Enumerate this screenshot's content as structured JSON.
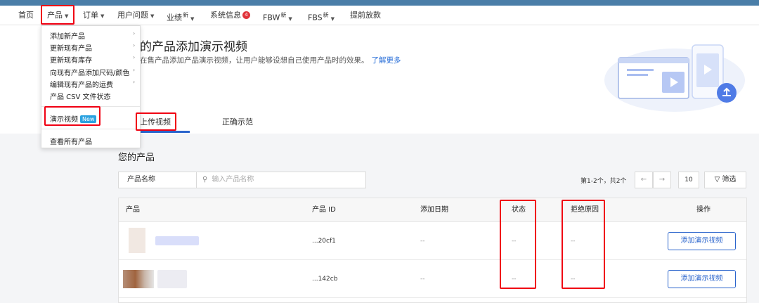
{
  "nav": {
    "home": "首页",
    "products": "产品",
    "orders": "订单",
    "user_issues": "用户问题",
    "performance": "业绩",
    "performance_sup": "新",
    "system_info": "系统信息",
    "system_info_badge": "4",
    "fbw": "FBW",
    "fbw_sup": "新",
    "fbs": "FBS",
    "fbs_sup": "新",
    "advance_payment": "提前放款"
  },
  "dropdown": {
    "items": [
      "添加新产品",
      "更新现有产品",
      "更新现有库存",
      "向现有产品添加尺码/颜色",
      "编辑现有产品的运费",
      "产品 CSV 文件状态"
    ],
    "demo_video": "演示视频",
    "new_badge": "New",
    "view_all": "查看所有产品"
  },
  "page": {
    "title": "为您的产品添加演示视频",
    "title_visible": "的产品添加演示视频",
    "desc": "在售产品添加产品演示视频，让用户能够设想自己使用产品时的效果。",
    "learn_more": "了解更多"
  },
  "tabs": {
    "upload": "上传视频",
    "example": "正确示范"
  },
  "section_title": "您的产品",
  "filter": {
    "field": "产品名称",
    "placeholder": "输入产品名称",
    "filter_button": "筛选"
  },
  "pager": {
    "text": "第1-2个，共2个",
    "page_size": "10",
    "prev": "←",
    "next": "→"
  },
  "table": {
    "headers": {
      "product": "产品",
      "product_id": "产品 ID",
      "date_added": "添加日期",
      "status": "状态",
      "reject_reason": "拒绝原因",
      "actions": "操作"
    },
    "rows": [
      {
        "product_id": "...20cf1",
        "date_added": "--",
        "status": "--",
        "reject_reason": "--",
        "action": "添加演示视频"
      },
      {
        "product_id": "...142cb",
        "date_added": "--",
        "status": "--",
        "reject_reason": "--",
        "action": "添加演示视频"
      }
    ]
  },
  "colors": {
    "accent": "#2a64cc",
    "highlight": "#f00012",
    "topbar": "#4a7ea8"
  }
}
